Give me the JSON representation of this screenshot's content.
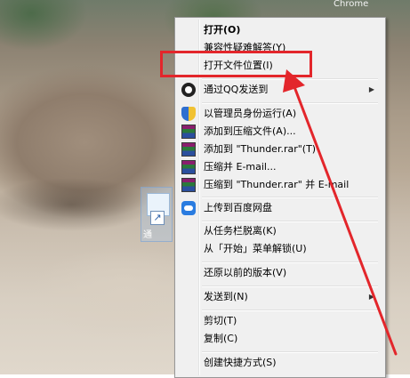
{
  "desktop": {
    "top_labels": [
      "Chrome"
    ],
    "icon_label": "通"
  },
  "context_menu": {
    "items": [
      {
        "label": "打开(O)",
        "bold": true,
        "icon": ""
      },
      {
        "label": "兼容性疑难解答(Y)",
        "bold": false,
        "icon": ""
      },
      {
        "label": "打开文件位置(I)",
        "bold": false,
        "icon": ""
      },
      {
        "label": "通过QQ发送到",
        "bold": false,
        "icon": "qq-icon",
        "submenu": true
      },
      {
        "label": "以管理员身份运行(A)",
        "bold": false,
        "icon": "uac-shield-icon"
      },
      {
        "label": "添加到压缩文件(A)...",
        "bold": false,
        "icon": "winrar-icon"
      },
      {
        "label": "添加到 \"Thunder.rar\"(T)",
        "bold": false,
        "icon": "winrar-icon"
      },
      {
        "label": "压缩并 E-mail...",
        "bold": false,
        "icon": "winrar-icon"
      },
      {
        "label": "压缩到 \"Thunder.rar\" 并 E-mail",
        "bold": false,
        "icon": "winrar-icon"
      },
      {
        "label": "上传到百度网盘",
        "bold": false,
        "icon": "baidu-netdisk-icon"
      },
      {
        "label": "从任务栏脱离(K)",
        "bold": false,
        "icon": ""
      },
      {
        "label": "从「开始」菜单解锁(U)",
        "bold": false,
        "icon": ""
      },
      {
        "label": "还原以前的版本(V)",
        "bold": false,
        "icon": ""
      },
      {
        "label": "发送到(N)",
        "bold": false,
        "icon": "",
        "submenu": true
      },
      {
        "label": "剪切(T)",
        "bold": false,
        "icon": ""
      },
      {
        "label": "复制(C)",
        "bold": false,
        "icon": ""
      },
      {
        "label": "创建快捷方式(S)",
        "bold": false,
        "icon": ""
      }
    ],
    "submenu_glyph": "▶"
  },
  "annotation": {
    "highlight_color": "#e3262b",
    "arrow_color": "#e3262b"
  }
}
